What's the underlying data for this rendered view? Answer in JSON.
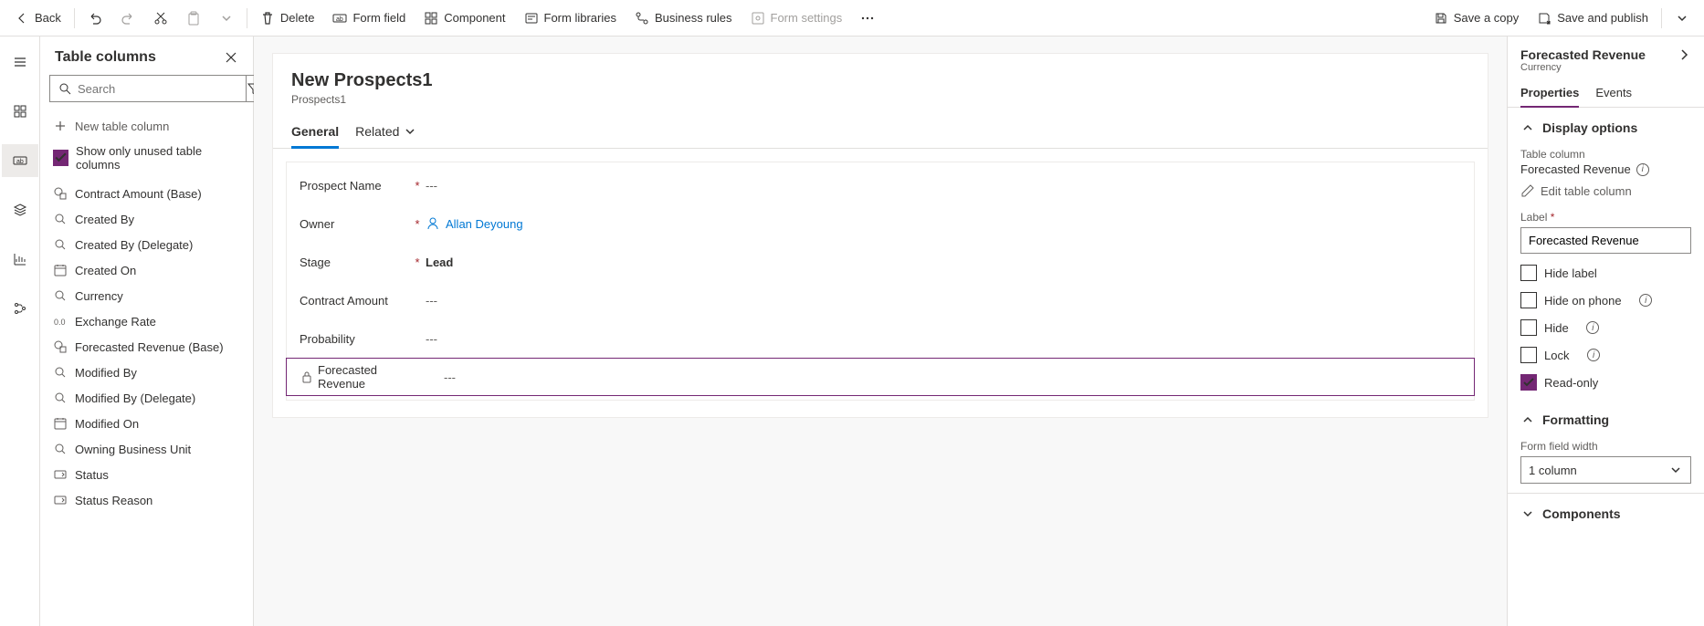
{
  "toolbar": {
    "back": "Back",
    "delete": "Delete",
    "formfield": "Form field",
    "component": "Component",
    "formlibs": "Form libraries",
    "bizrules": "Business rules",
    "formsettings": "Form settings",
    "savecopy": "Save a copy",
    "savepublish": "Save and publish"
  },
  "leftPanel": {
    "title": "Table columns",
    "searchPlaceholder": "Search",
    "newColumn": "New table column",
    "showUnused": "Show only unused table columns",
    "columns": [
      {
        "label": "Contract Amount (Base)",
        "icon": "currency-calc"
      },
      {
        "label": "Created By",
        "icon": "lookup"
      },
      {
        "label": "Created By (Delegate)",
        "icon": "lookup"
      },
      {
        "label": "Created On",
        "icon": "datetime"
      },
      {
        "label": "Currency",
        "icon": "lookup"
      },
      {
        "label": "Exchange Rate",
        "icon": "decimal"
      },
      {
        "label": "Forecasted Revenue (Base)",
        "icon": "currency-calc"
      },
      {
        "label": "Modified By",
        "icon": "lookup"
      },
      {
        "label": "Modified By (Delegate)",
        "icon": "lookup"
      },
      {
        "label": "Modified On",
        "icon": "datetime"
      },
      {
        "label": "Owning Business Unit",
        "icon": "lookup"
      },
      {
        "label": "Status",
        "icon": "optionset"
      },
      {
        "label": "Status Reason",
        "icon": "optionset"
      }
    ]
  },
  "form": {
    "title": "New Prospects1",
    "subtitle": "Prospects1",
    "tabGeneral": "General",
    "tabRelated": "Related",
    "rows": [
      {
        "name": "Prospect Name",
        "required": true,
        "value": "---",
        "type": "text"
      },
      {
        "name": "Owner",
        "required": true,
        "value": "Allan Deyoung",
        "type": "user"
      },
      {
        "name": "Stage",
        "required": true,
        "value": "Lead",
        "type": "bold"
      },
      {
        "name": "Contract Amount",
        "required": false,
        "value": "---",
        "type": "text"
      },
      {
        "name": "Probability",
        "required": false,
        "value": "---",
        "type": "text"
      },
      {
        "name": "Forecasted Revenue",
        "required": false,
        "value": "---",
        "type": "text",
        "locked": true,
        "selected": true
      }
    ]
  },
  "rightPanel": {
    "title": "Forecasted Revenue",
    "subtitle": "Currency",
    "tabProps": "Properties",
    "tabEvents": "Events",
    "displayOptions": "Display options",
    "tableColumnLabel": "Table column",
    "tableColumnValue": "Forecasted Revenue",
    "editLink": "Edit table column",
    "labelLabel": "Label",
    "labelValue": "Forecasted Revenue",
    "hideLabel": "Hide label",
    "hideOnPhone": "Hide on phone",
    "hide": "Hide",
    "lock": "Lock",
    "readonly": "Read-only",
    "formatting": "Formatting",
    "widthLabel": "Form field width",
    "widthValue": "1 column",
    "components": "Components"
  }
}
